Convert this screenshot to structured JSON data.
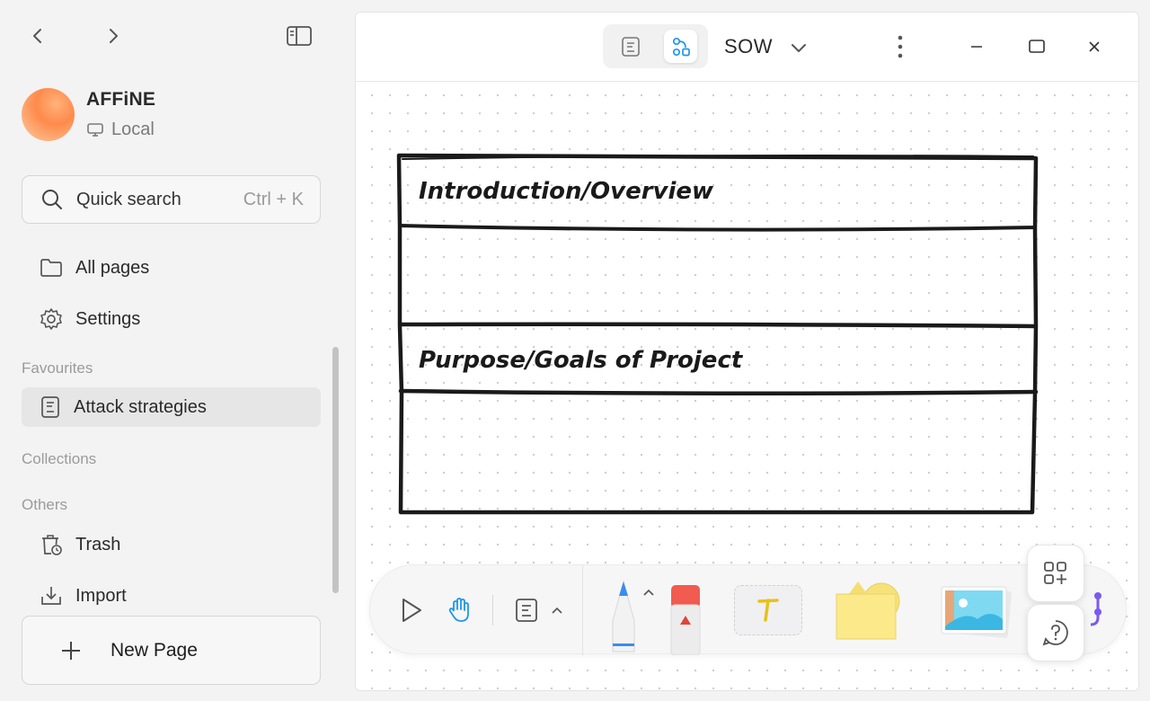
{
  "sidebar": {
    "workspace": {
      "name": "AFFiNE",
      "type": "Local"
    },
    "search": {
      "label": "Quick search",
      "shortcut": "Ctrl + K"
    },
    "nav": {
      "all_pages": "All pages",
      "settings": "Settings"
    },
    "sections": {
      "favourites": "Favourites",
      "collections": "Collections",
      "others": "Others"
    },
    "favourites": [
      {
        "label": "Attack strategies"
      }
    ],
    "others": {
      "trash": "Trash",
      "import": "Import"
    },
    "new_page": "New Page"
  },
  "header": {
    "title": "SOW",
    "mode": "edgeless"
  },
  "canvas": {
    "rows": [
      {
        "heading": "Introduction/Overview"
      },
      {
        "heading": ""
      },
      {
        "heading": "Purpose/Goals of Project"
      },
      {
        "heading": ""
      }
    ]
  },
  "toolbar": {
    "tools": [
      "select-icon",
      "hand-icon",
      "note-icon",
      "pen-icon",
      "eraser-icon",
      "text-icon",
      "shape-icon",
      "image-icon",
      "connector-icon"
    ],
    "active_tool": "hand"
  },
  "colors": {
    "accent": "#1e96eb",
    "sticky": "#fbe98a",
    "eraser_red": "#f25b4f"
  }
}
